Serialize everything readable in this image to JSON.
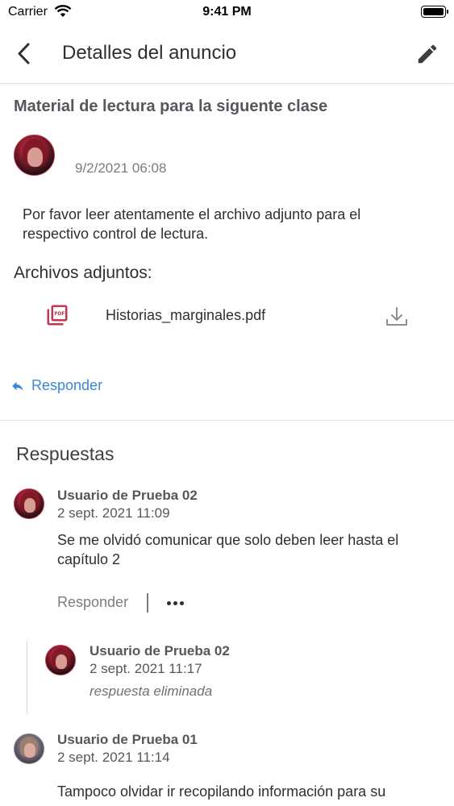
{
  "status_bar": {
    "carrier": "Carrier",
    "time": "9:41 PM"
  },
  "header": {
    "title": "Detalles del anuncio",
    "back_icon": "chevron-left-icon",
    "edit_icon": "pencil-icon"
  },
  "announcement": {
    "title": "Material de lectura para la siguente clase",
    "date": "9/2/2021 06:08",
    "body": "Por favor leer atentamente el archivo adjunto para el respectivo control de lectura.",
    "attachments_heading": "Archivos adjuntos:",
    "attachments": [
      {
        "name": "Historias_marginales.pdf",
        "icon": "pdf-icon",
        "action_icon": "download-icon"
      }
    ],
    "reply_label": "Responder"
  },
  "responses": {
    "heading": "Respuestas",
    "items": [
      {
        "author": "Usuario de Prueba 02",
        "date": "2 sept. 2021 11:09",
        "text": "Se me olvidó comunicar que solo deben leer hasta el capítulo 2",
        "reply_label": "Responder",
        "replies": [
          {
            "author": "Usuario de Prueba 02",
            "date": "2 sept. 2021 11:17",
            "deleted_text": "respuesta eliminada"
          }
        ]
      },
      {
        "author": "Usuario de Prueba 01",
        "date": "2 sept. 2021 11:14",
        "text": "Tampoco olvidar ir recopilando información para su"
      }
    ]
  },
  "colors": {
    "accent": "#3b87d6",
    "pdf": "#c8354e",
    "text": "#2f2f33",
    "muted": "#7a7c80"
  }
}
